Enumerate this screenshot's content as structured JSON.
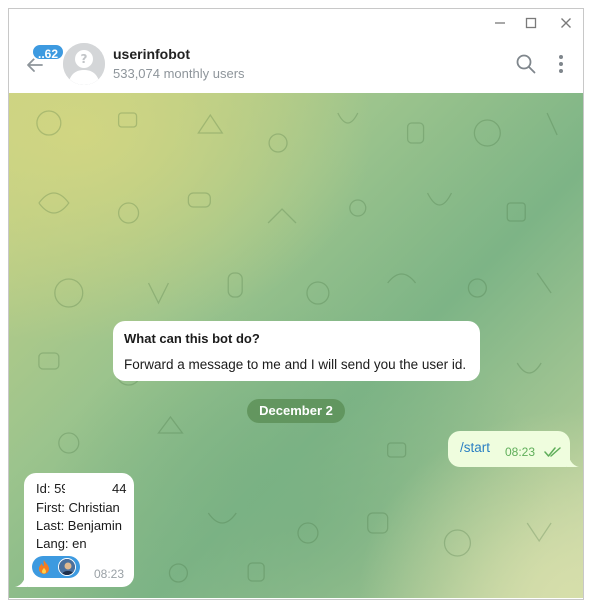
{
  "window": {
    "controls": {
      "minimize_icon": "minimize-icon",
      "maximize_icon": "maximize-icon",
      "close_icon": "close-icon"
    }
  },
  "header": {
    "unread_count": "..62",
    "chat_name": "userinfobot",
    "status": "533,074 monthly users",
    "icons": {
      "back": "arrow-left-icon",
      "search": "search-icon",
      "more": "more-vertical-icon"
    }
  },
  "bot_info": {
    "title": "What can this bot do?",
    "description": "Forward a message to me and I will send you the user id."
  },
  "date_separator": "December 2",
  "messages": {
    "outgoing": {
      "text": "/start",
      "time": "08:23",
      "status_icon": "double-check-icon"
    },
    "incoming": {
      "lines": [
        "Id: 59",
        "First: Christian",
        "Last: Benjamin",
        "Lang: en"
      ],
      "id_suffix": "44",
      "time": "08:23",
      "reaction": {
        "emoji": "fire-icon",
        "reactor": "user-avatar"
      }
    }
  },
  "colors": {
    "accent": "#3d9ae0",
    "outgoing_bubble": "#effdde",
    "outgoing_text": "#2a7fc3",
    "check_color": "#5fae5a",
    "date_pill": "#588a50"
  }
}
